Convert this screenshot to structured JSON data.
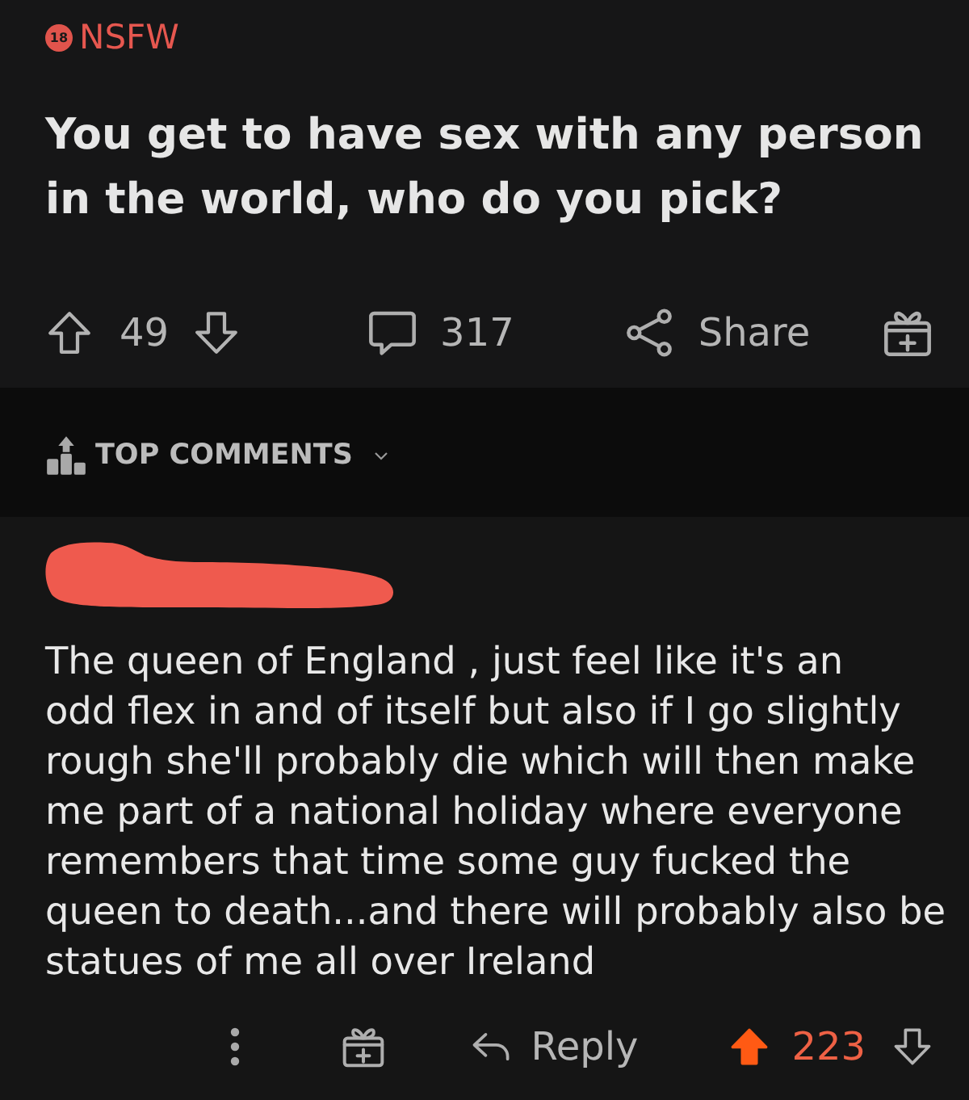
{
  "post": {
    "nsfw": {
      "badge": "18",
      "label": "NSFW"
    },
    "title": "You get to have sex with any person\nin the world, who do you pick?",
    "upvoted": false,
    "score": "49",
    "comments": "317",
    "share": "Share"
  },
  "comments_sort": {
    "label": "TOP COMMENTS"
  },
  "comment": {
    "author_redacted": true,
    "body": "The queen of England , just feel like it's an\nodd flex in and of itself but also if I go slightly\nrough she'll probably die which will then make\nme part of a national holiday where everyone\nremembers that time some guy fucked the\nqueen to death...and there will probably also be\nstatues of me all over Ireland",
    "reply": "Reply",
    "upvoted": true,
    "score": "223"
  }
}
